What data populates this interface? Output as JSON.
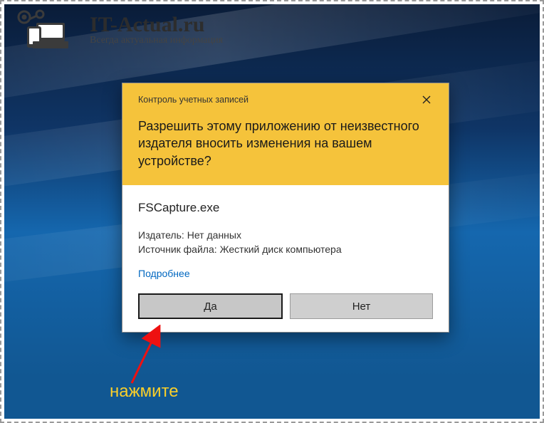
{
  "watermark": {
    "title": "IT-Actual.ru",
    "subtitle": "Всегда актуальная информация"
  },
  "uac": {
    "titlebar": "Контроль учетных записей",
    "question": "Разрешить этому приложению от неизвестного издателя вносить изменения на вашем устройстве?",
    "app_name": "FSCapture.exe",
    "publisher_label": "Издатель:",
    "publisher_value": "Нет данных",
    "source_label": "Источник файла:",
    "source_value": "Жесткий диск компьютера",
    "details_link": "Подробнее",
    "yes_label": "Да",
    "no_label": "Нет"
  },
  "annotation": {
    "label": "нажмите"
  }
}
